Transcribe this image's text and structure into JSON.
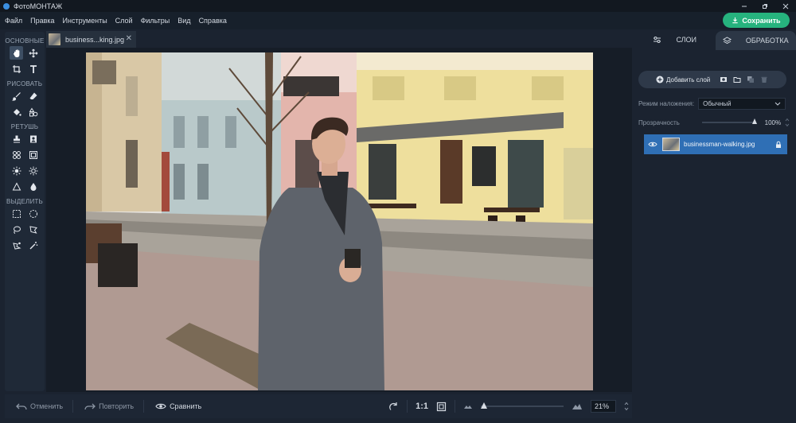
{
  "window": {
    "title": "ФотоМОНТАЖ"
  },
  "menu": {
    "items": [
      "Файл",
      "Правка",
      "Инструменты",
      "Слой",
      "Фильтры",
      "Вид",
      "Справка"
    ],
    "save_label": "Сохранить"
  },
  "tools": {
    "sections": [
      "ОСНОВНЫЕ",
      "РИСОВАТЬ",
      "РЕТУШЬ",
      "ВЫДЕЛИТЬ"
    ]
  },
  "document": {
    "tab_name": "business...king.jpg"
  },
  "bottombar": {
    "undo_label": "Отменить",
    "redo_label": "Повторить",
    "compare_label": "Сравнить",
    "ratio_label": "1:1",
    "zoom_value": "21%"
  },
  "right_panel": {
    "tabs": [
      "СЛОИ",
      "ОБРАБОТКА"
    ],
    "add_layer_label": "Добавить слой",
    "blend_mode_label": "Режим наложения:",
    "blend_mode_value": "Обычный",
    "opacity_label": "Прозрачность",
    "opacity_value": "100%",
    "layer_name": "businessman-walking.jpg"
  },
  "colors": {
    "accent_green": "#26b37e",
    "selected_layer": "#2f6fb5"
  }
}
